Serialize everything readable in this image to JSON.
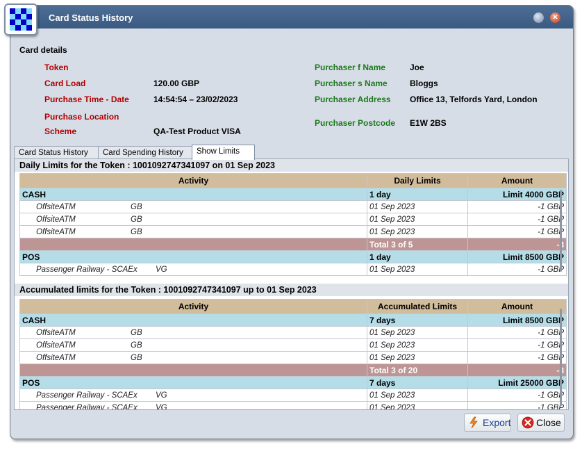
{
  "window": {
    "title": "Card Status History"
  },
  "card_details": {
    "section_title": "Card details",
    "left": [
      {
        "label": "Token",
        "value": ""
      },
      {
        "label": "Card Load",
        "value": "120.00 GBP"
      },
      {
        "label": "Purchase Time - Date",
        "value": "14:54:54 – 23/02/2023"
      },
      {
        "label": "Purchase Location",
        "value": ""
      },
      {
        "label": "Scheme",
        "value": "QA-Test Product VISA"
      }
    ],
    "right": [
      {
        "label": "Purchaser f Name",
        "value": "Joe"
      },
      {
        "label": "Purchaser s Name",
        "value": "Bloggs"
      },
      {
        "label": "Purchaser Address",
        "value": "Office 13, Telfords Yard, London"
      },
      {
        "label": "Purchaser Postcode",
        "value": "E1W 2BS"
      }
    ]
  },
  "tabs": [
    "Card Status History",
    "Card Spending History",
    "Show Limits"
  ],
  "daily": {
    "heading": "Daily Limits for the Token : 1001092747341097 on 01 Sep 2023",
    "headers": [
      "Activity",
      "Daily Limits",
      "Amount"
    ],
    "cash": {
      "name": "CASH",
      "period": "1 day",
      "limit": "Limit 4000 GBP"
    },
    "cash_items": [
      {
        "activity": "OffsiteATM",
        "region": "GB",
        "date": "01 Sep 2023",
        "amount": "-1 GBP"
      },
      {
        "activity": "OffsiteATM",
        "region": "GB",
        "date": "01 Sep 2023",
        "amount": "-1 GBP"
      },
      {
        "activity": "OffsiteATM",
        "region": "GB",
        "date": "01 Sep 2023",
        "amount": "-1 GBP"
      }
    ],
    "cash_total": {
      "label": "Total 3 of 5",
      "amount": "-3"
    },
    "pos": {
      "name": "POS",
      "period": "1 day",
      "limit": "Limit 8500 GBP"
    },
    "pos_items": [
      {
        "activity": "Passenger Railway - SCAEx",
        "region": "VG",
        "date": "01 Sep 2023",
        "amount": "-1 GBP"
      }
    ]
  },
  "accumulated": {
    "heading": "Accumulated limits for the Token : 1001092747341097 up to 01 Sep 2023",
    "headers": [
      "Activity",
      "Accumulated Limits",
      "Amount"
    ],
    "cash": {
      "name": "CASH",
      "period": "7 days",
      "limit": "Limit 8500 GBP"
    },
    "cash_items": [
      {
        "activity": "OffsiteATM",
        "region": "GB",
        "date": "01 Sep 2023",
        "amount": "-1 GBP"
      },
      {
        "activity": "OffsiteATM",
        "region": "GB",
        "date": "01 Sep 2023",
        "amount": "-1 GBP"
      },
      {
        "activity": "OffsiteATM",
        "region": "GB",
        "date": "01 Sep 2023",
        "amount": "-1 GBP"
      }
    ],
    "cash_total": {
      "label": "Total 3 of 20",
      "amount": "-3"
    },
    "pos": {
      "name": "POS",
      "period": "7 days",
      "limit": "Limit 25000 GBP"
    },
    "pos_items": [
      {
        "activity": "Passenger Railway - SCAEx",
        "region": "VG",
        "date": "01 Sep 2023",
        "amount": "-1 GBP"
      },
      {
        "activity": "Passenger Railway - SCAEx",
        "region": "VG",
        "date": "01 Sep 2023",
        "amount": "-1 GBP"
      }
    ]
  },
  "buttons": {
    "export": "Export",
    "close": "Close"
  },
  "colors": {
    "title_bar": "#3f5f88",
    "label_red": "#b10000",
    "label_green": "#1a7a1a",
    "table_header": "#d1bc9b",
    "category_row": "#b4dde8",
    "total_row": "#bd9594"
  }
}
